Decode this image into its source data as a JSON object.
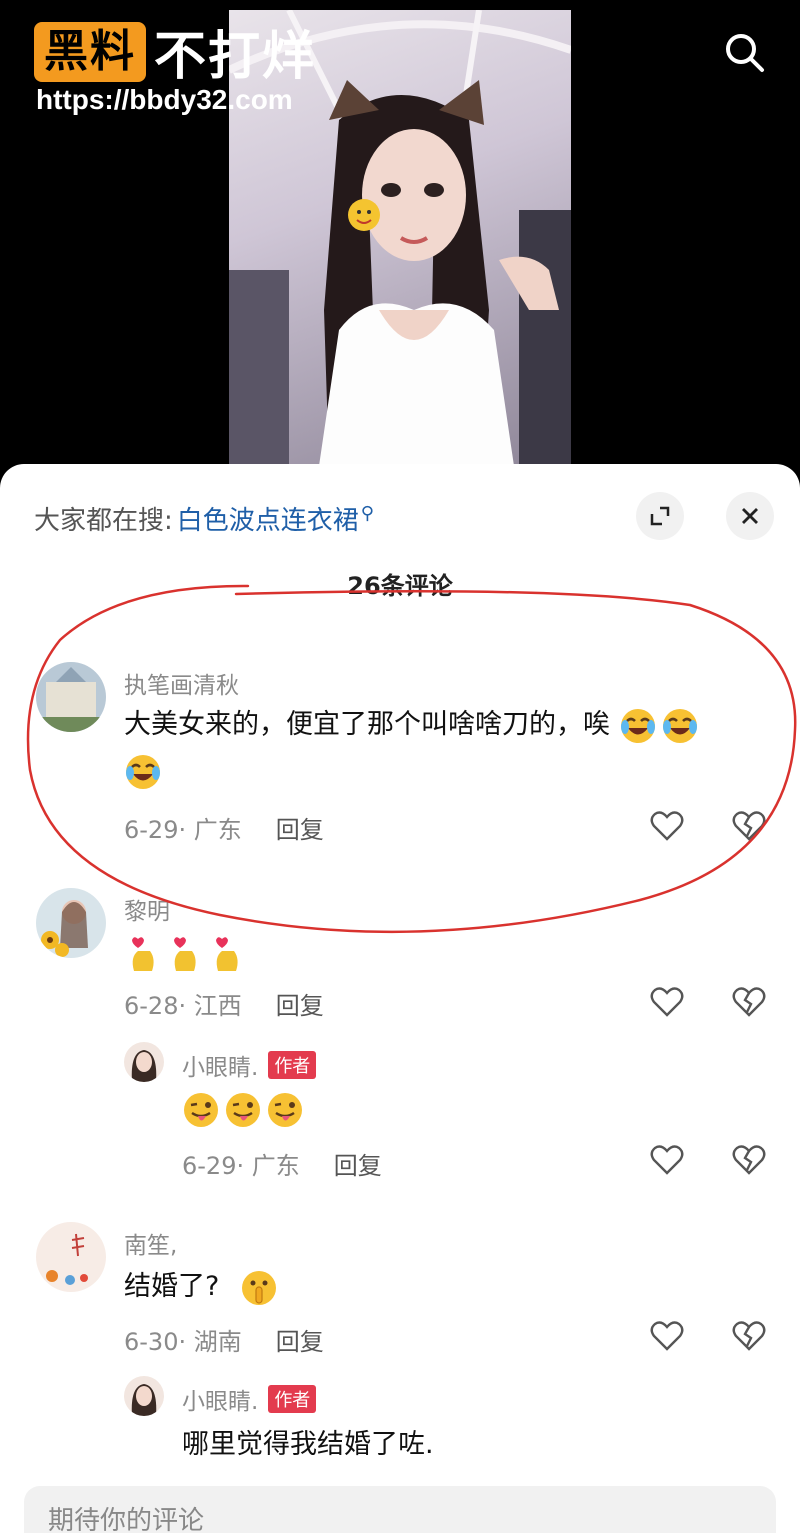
{
  "watermark": {
    "logo_box": "黑料",
    "logo_text": "不打烊",
    "url": "https://bbdy32.com"
  },
  "header": {
    "search_icon": "search-icon"
  },
  "sheet": {
    "hot_search_label": "大家都在搜:",
    "hot_search_keyword": "白色波点连衣裙",
    "comment_count": "26条评论",
    "expand_icon": "expand-icon",
    "close_icon": "close-icon"
  },
  "comments": [
    {
      "user": "执笔画清秋",
      "text_line1": "大美女来的，便宜了那个叫啥啥刀的，唉",
      "date_loc": "6-29· 广东",
      "reply_label": "回复",
      "emojis": [
        "crying-laughing-emoji",
        "crying-laughing-emoji",
        "crying-laughing-emoji"
      ]
    },
    {
      "user": "黎明",
      "date_loc": "6-28· 江西",
      "reply_label": "回复",
      "emojis": [
        "finger-heart-emoji",
        "finger-heart-emoji",
        "finger-heart-emoji"
      ],
      "reply": {
        "user": "小眼睛.",
        "tag": "作者",
        "date_loc": "6-29· 广东",
        "reply_label": "回复",
        "emojis": [
          "tongue-out-emoji",
          "tongue-out-emoji",
          "tongue-out-emoji"
        ]
      }
    },
    {
      "user": "南笙,",
      "text": "结婚了?",
      "date_loc": "6-30· 湖南",
      "reply_label": "回复",
      "emojis": [
        "shush-emoji"
      ],
      "reply": {
        "user": "小眼睛.",
        "tag": "作者",
        "text": "哪里觉得我结婚了咗."
      }
    }
  ],
  "input": {
    "placeholder": "期待你的评论"
  },
  "colors": {
    "accent_link": "#1f5fa8",
    "author_tag": "#e33b4e",
    "annotation": "#d9322e",
    "logo_orange": "#f39a1f"
  }
}
